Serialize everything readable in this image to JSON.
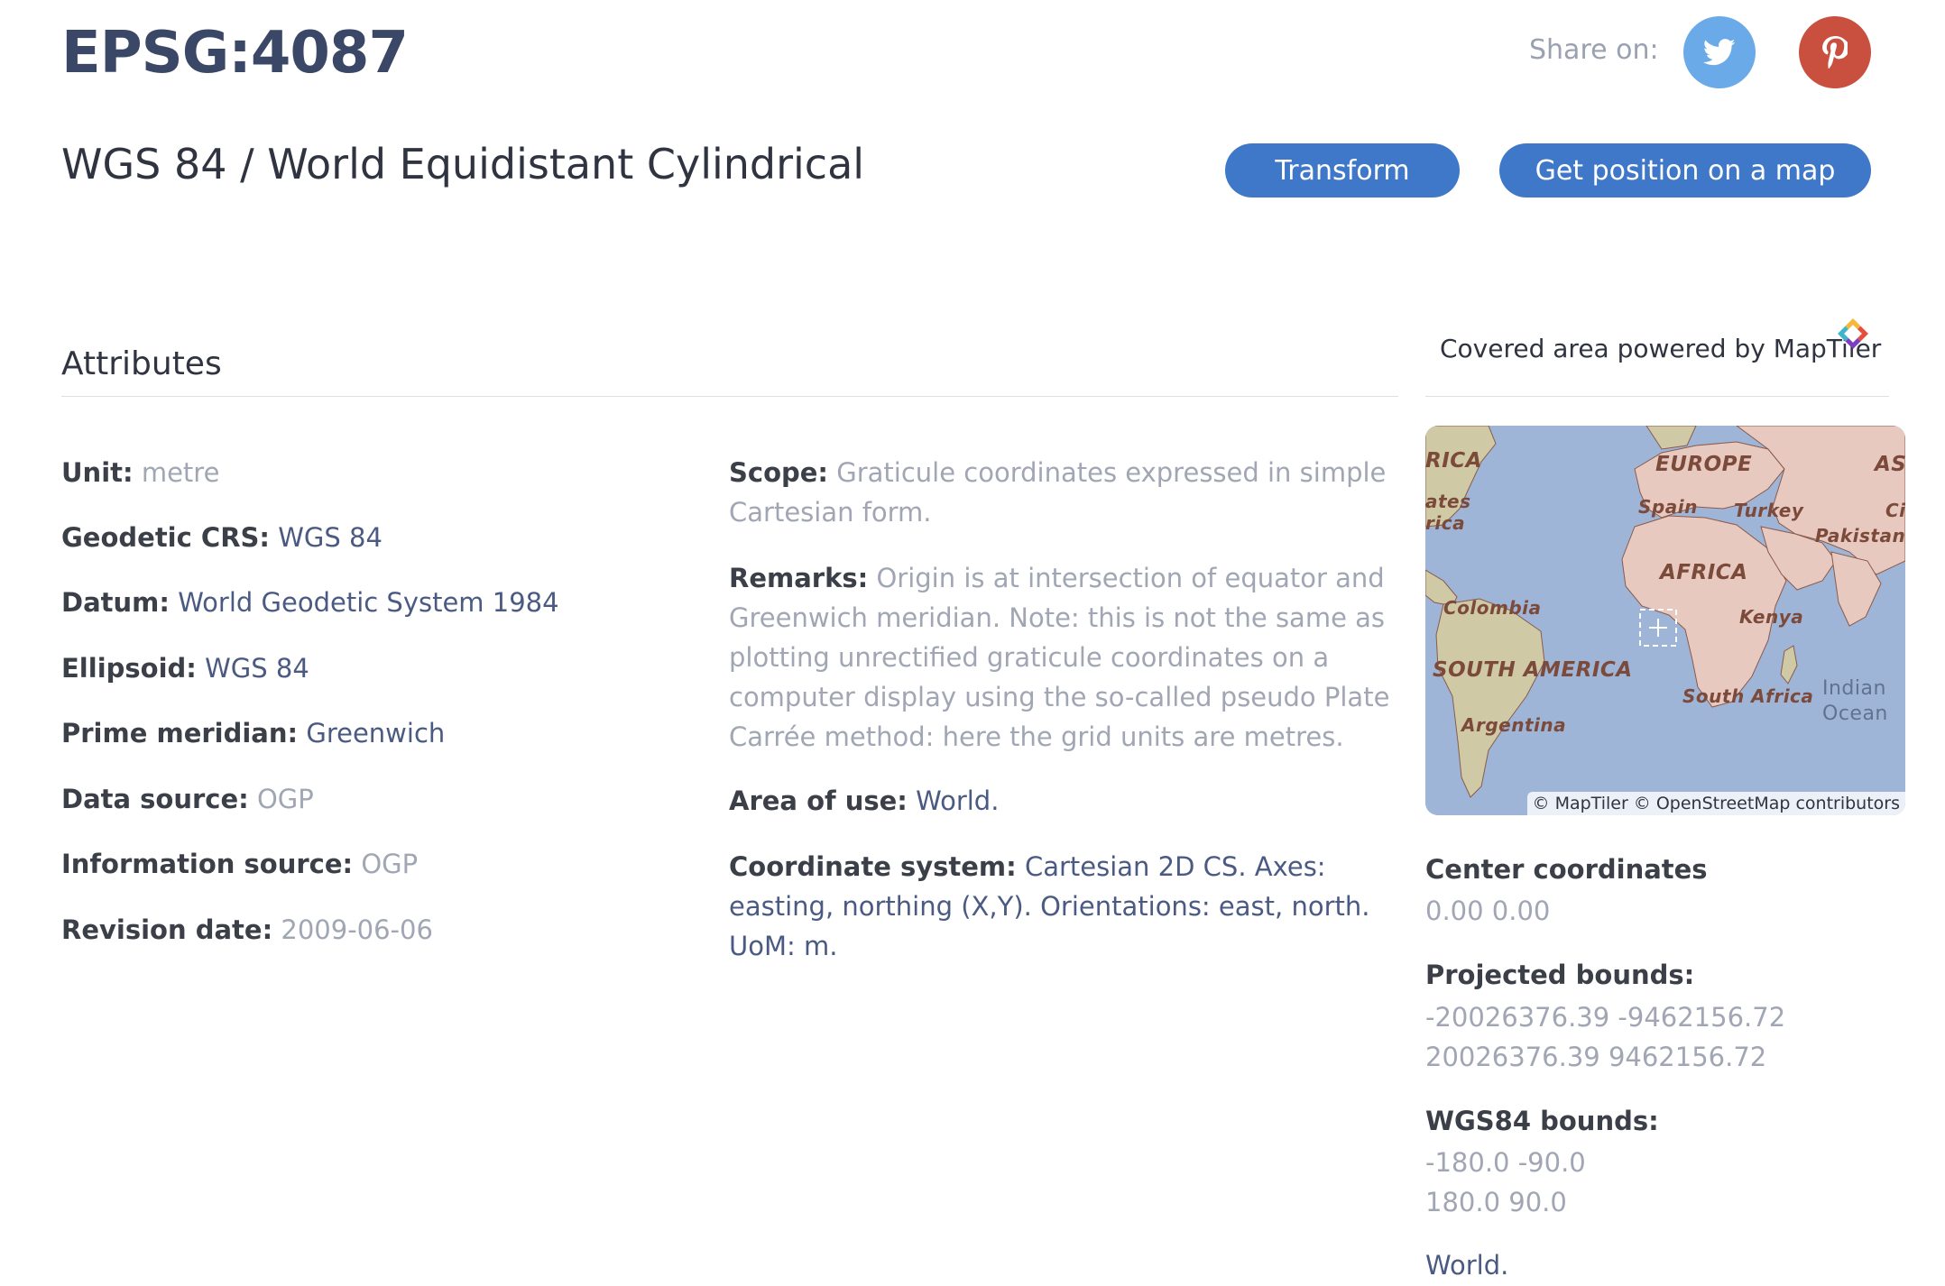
{
  "header": {
    "code": "EPSG:4087",
    "title": "WGS 84 / World Equidistant Cylindrical",
    "share_label": "Share on:",
    "transform_label": "Transform",
    "map_label": "Get position on a map"
  },
  "attributes": {
    "heading": "Attributes",
    "left": [
      {
        "label": "Unit:",
        "value": "metre",
        "style": "muted"
      },
      {
        "label": "Geodetic CRS:",
        "value": "WGS 84",
        "style": "link"
      },
      {
        "label": "Datum:",
        "value": "World Geodetic System 1984",
        "style": "link"
      },
      {
        "label": "Ellipsoid:",
        "value": "WGS 84",
        "style": "link"
      },
      {
        "label": "Prime meridian:",
        "value": "Greenwich",
        "style": "link"
      },
      {
        "label": "Data source:",
        "value": "OGP",
        "style": "muted"
      },
      {
        "label": "Information source:",
        "value": "OGP",
        "style": "muted"
      },
      {
        "label": "Revision date:",
        "value": "2009-06-06",
        "style": "muted"
      }
    ],
    "scope": {
      "label": "Scope:",
      "value": "Graticule coordinates expressed in simple Cartesian form."
    },
    "remarks": {
      "label": "Remarks:",
      "value": "Origin is at intersection of equator and Greenwich meridian. Note: this is not the same as plotting unrectified graticule coordinates on a computer display using the so-called pseudo Plate Carrée method: here the grid units are metres."
    },
    "area": {
      "label": "Area of use:",
      "value": "World."
    },
    "coord_system": {
      "label": "Coordinate system:",
      "value": "Cartesian 2D CS. Axes: easting, northing (X,Y). Orientations: east, north. UoM: m."
    }
  },
  "map_panel": {
    "covered_label": "Covered area powered by MapTiler",
    "attribution": "© MapTiler © OpenStreetMap contributors",
    "labels": {
      "rica": "RICA",
      "ates": "ates",
      "ica": "rica",
      "europe": "EUROPE",
      "asia": "ASI",
      "spain": "Spain",
      "turkey": "Turkey",
      "pakistan": "Pakistan",
      "africa": "AFRICA",
      "colombia": "Colombia",
      "kenya": "Kenya",
      "south_america": "SOUTH AMERICA",
      "south_africa": "South Africa",
      "indian": "Indian",
      "ocean": "Ocean",
      "argentina": "Argentina",
      "ci": "Ci"
    },
    "colors": {
      "ocean": "#9fb5d8",
      "land": "#cfc9a6",
      "land_pink": "#e8c9c0",
      "border": "#8a5a4a"
    }
  },
  "info": {
    "center_label": "Center coordinates",
    "center_value": "0.00 0.00",
    "projected_label": "Projected bounds:",
    "projected_line1": "-20026376.39 -9462156.72",
    "projected_line2": "20026376.39 9462156.72",
    "wgs_label": "WGS84 bounds:",
    "wgs_line1": "-180.0 -90.0",
    "wgs_line2": "180.0 90.0",
    "area": "World."
  }
}
